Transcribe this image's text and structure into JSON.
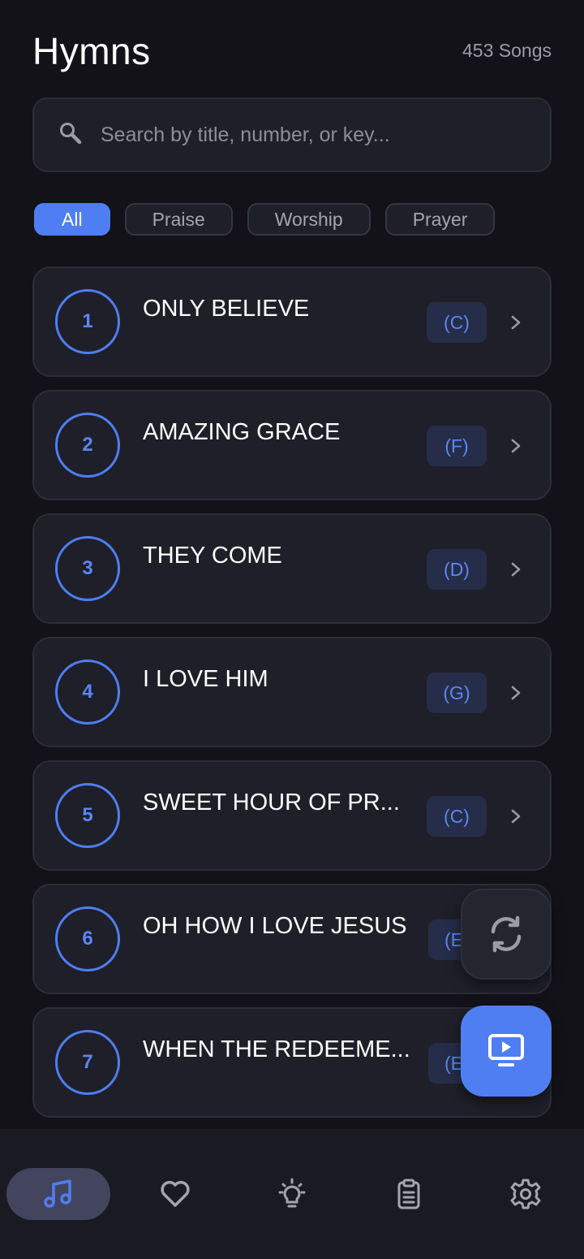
{
  "header": {
    "title": "Hymns",
    "song_count": "453 Songs"
  },
  "search": {
    "placeholder": "Search by title, number, or key...",
    "value": ""
  },
  "filters": [
    {
      "label": "All",
      "active": true
    },
    {
      "label": "Praise",
      "active": false
    },
    {
      "label": "Worship",
      "active": false
    },
    {
      "label": "Prayer",
      "active": false
    }
  ],
  "songs": [
    {
      "number": "1",
      "title": "ONLY BELIEVE",
      "key": "(C)"
    },
    {
      "number": "2",
      "title": "AMAZING GRACE",
      "key": "(F)"
    },
    {
      "number": "3",
      "title": "THEY COME",
      "key": "(D)"
    },
    {
      "number": "4",
      "title": "I LOVE HIM",
      "key": "(G)"
    },
    {
      "number": "5",
      "title": "SWEET HOUR OF PR...",
      "key": "(C)"
    },
    {
      "number": "6",
      "title": "OH HOW I LOVE JESUS",
      "key": "(E"
    },
    {
      "number": "7",
      "title": "WHEN THE REDEEME...",
      "key": "(E"
    }
  ],
  "fabs": {
    "refresh_icon": "refresh-icon",
    "present_icon": "present-screen-icon"
  },
  "bottom_nav": [
    {
      "icon": "music-note-icon",
      "active": true
    },
    {
      "icon": "heart-icon",
      "active": false
    },
    {
      "icon": "lightbulb-icon",
      "active": false
    },
    {
      "icon": "clipboard-icon",
      "active": false
    },
    {
      "icon": "gear-icon",
      "active": false
    }
  ],
  "colors": {
    "background": "#121218",
    "card": "#1f1f29",
    "accent": "#4f7ef3",
    "text_muted": "#9a9ca8"
  }
}
